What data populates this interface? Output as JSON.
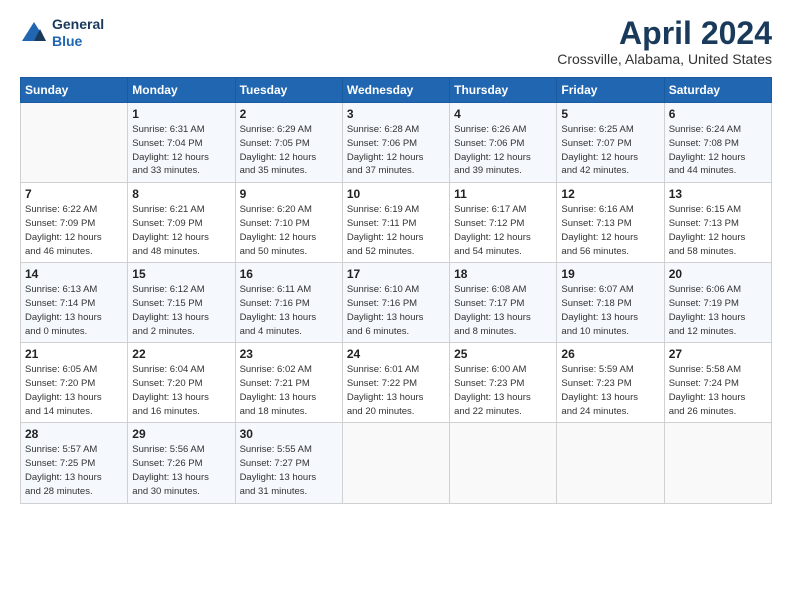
{
  "header": {
    "logo_line1": "General",
    "logo_line2": "Blue",
    "month_title": "April 2024",
    "location": "Crossville, Alabama, United States"
  },
  "weekdays": [
    "Sunday",
    "Monday",
    "Tuesday",
    "Wednesday",
    "Thursday",
    "Friday",
    "Saturday"
  ],
  "weeks": [
    [
      {
        "day": "",
        "info": ""
      },
      {
        "day": "1",
        "info": "Sunrise: 6:31 AM\nSunset: 7:04 PM\nDaylight: 12 hours\nand 33 minutes."
      },
      {
        "day": "2",
        "info": "Sunrise: 6:29 AM\nSunset: 7:05 PM\nDaylight: 12 hours\nand 35 minutes."
      },
      {
        "day": "3",
        "info": "Sunrise: 6:28 AM\nSunset: 7:06 PM\nDaylight: 12 hours\nand 37 minutes."
      },
      {
        "day": "4",
        "info": "Sunrise: 6:26 AM\nSunset: 7:06 PM\nDaylight: 12 hours\nand 39 minutes."
      },
      {
        "day": "5",
        "info": "Sunrise: 6:25 AM\nSunset: 7:07 PM\nDaylight: 12 hours\nand 42 minutes."
      },
      {
        "day": "6",
        "info": "Sunrise: 6:24 AM\nSunset: 7:08 PM\nDaylight: 12 hours\nand 44 minutes."
      }
    ],
    [
      {
        "day": "7",
        "info": "Sunrise: 6:22 AM\nSunset: 7:09 PM\nDaylight: 12 hours\nand 46 minutes."
      },
      {
        "day": "8",
        "info": "Sunrise: 6:21 AM\nSunset: 7:09 PM\nDaylight: 12 hours\nand 48 minutes."
      },
      {
        "day": "9",
        "info": "Sunrise: 6:20 AM\nSunset: 7:10 PM\nDaylight: 12 hours\nand 50 minutes."
      },
      {
        "day": "10",
        "info": "Sunrise: 6:19 AM\nSunset: 7:11 PM\nDaylight: 12 hours\nand 52 minutes."
      },
      {
        "day": "11",
        "info": "Sunrise: 6:17 AM\nSunset: 7:12 PM\nDaylight: 12 hours\nand 54 minutes."
      },
      {
        "day": "12",
        "info": "Sunrise: 6:16 AM\nSunset: 7:13 PM\nDaylight: 12 hours\nand 56 minutes."
      },
      {
        "day": "13",
        "info": "Sunrise: 6:15 AM\nSunset: 7:13 PM\nDaylight: 12 hours\nand 58 minutes."
      }
    ],
    [
      {
        "day": "14",
        "info": "Sunrise: 6:13 AM\nSunset: 7:14 PM\nDaylight: 13 hours\nand 0 minutes."
      },
      {
        "day": "15",
        "info": "Sunrise: 6:12 AM\nSunset: 7:15 PM\nDaylight: 13 hours\nand 2 minutes."
      },
      {
        "day": "16",
        "info": "Sunrise: 6:11 AM\nSunset: 7:16 PM\nDaylight: 13 hours\nand 4 minutes."
      },
      {
        "day": "17",
        "info": "Sunrise: 6:10 AM\nSunset: 7:16 PM\nDaylight: 13 hours\nand 6 minutes."
      },
      {
        "day": "18",
        "info": "Sunrise: 6:08 AM\nSunset: 7:17 PM\nDaylight: 13 hours\nand 8 minutes."
      },
      {
        "day": "19",
        "info": "Sunrise: 6:07 AM\nSunset: 7:18 PM\nDaylight: 13 hours\nand 10 minutes."
      },
      {
        "day": "20",
        "info": "Sunrise: 6:06 AM\nSunset: 7:19 PM\nDaylight: 13 hours\nand 12 minutes."
      }
    ],
    [
      {
        "day": "21",
        "info": "Sunrise: 6:05 AM\nSunset: 7:20 PM\nDaylight: 13 hours\nand 14 minutes."
      },
      {
        "day": "22",
        "info": "Sunrise: 6:04 AM\nSunset: 7:20 PM\nDaylight: 13 hours\nand 16 minutes."
      },
      {
        "day": "23",
        "info": "Sunrise: 6:02 AM\nSunset: 7:21 PM\nDaylight: 13 hours\nand 18 minutes."
      },
      {
        "day": "24",
        "info": "Sunrise: 6:01 AM\nSunset: 7:22 PM\nDaylight: 13 hours\nand 20 minutes."
      },
      {
        "day": "25",
        "info": "Sunrise: 6:00 AM\nSunset: 7:23 PM\nDaylight: 13 hours\nand 22 minutes."
      },
      {
        "day": "26",
        "info": "Sunrise: 5:59 AM\nSunset: 7:23 PM\nDaylight: 13 hours\nand 24 minutes."
      },
      {
        "day": "27",
        "info": "Sunrise: 5:58 AM\nSunset: 7:24 PM\nDaylight: 13 hours\nand 26 minutes."
      }
    ],
    [
      {
        "day": "28",
        "info": "Sunrise: 5:57 AM\nSunset: 7:25 PM\nDaylight: 13 hours\nand 28 minutes."
      },
      {
        "day": "29",
        "info": "Sunrise: 5:56 AM\nSunset: 7:26 PM\nDaylight: 13 hours\nand 30 minutes."
      },
      {
        "day": "30",
        "info": "Sunrise: 5:55 AM\nSunset: 7:27 PM\nDaylight: 13 hours\nand 31 minutes."
      },
      {
        "day": "",
        "info": ""
      },
      {
        "day": "",
        "info": ""
      },
      {
        "day": "",
        "info": ""
      },
      {
        "day": "",
        "info": ""
      }
    ]
  ]
}
